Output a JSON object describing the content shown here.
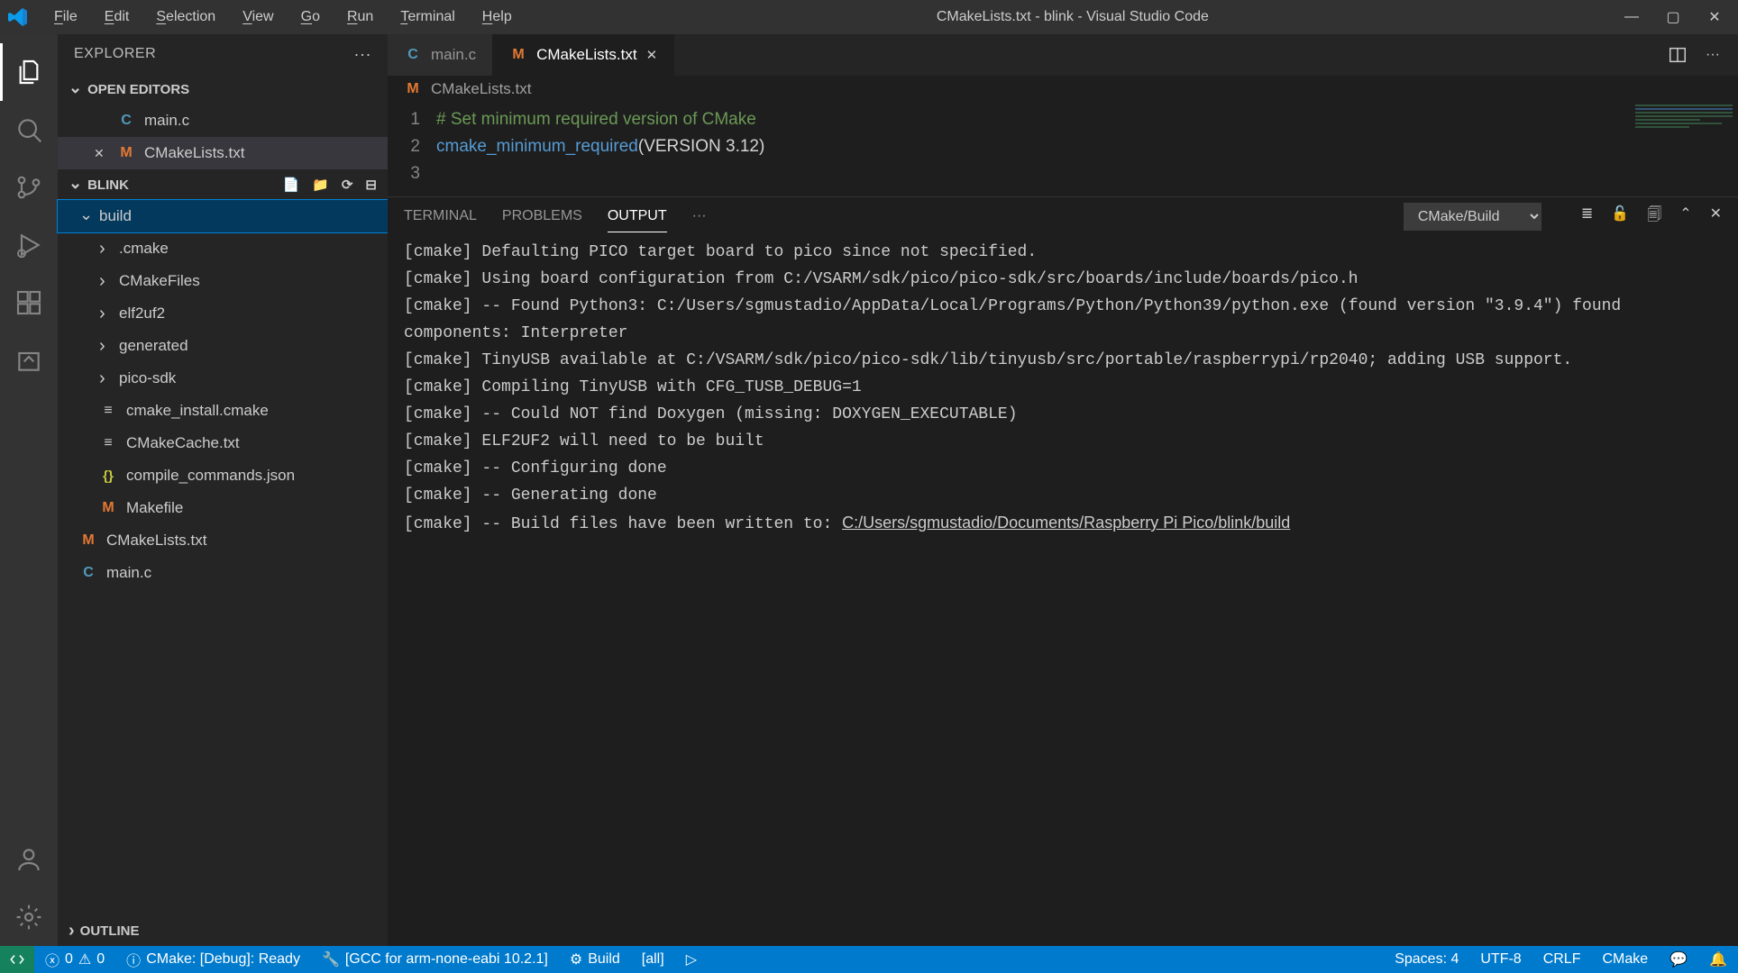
{
  "window": {
    "title": "CMakeLists.txt - blink - Visual Studio Code"
  },
  "menu": [
    "File",
    "Edit",
    "Selection",
    "View",
    "Go",
    "Run",
    "Terminal",
    "Help"
  ],
  "sidebar": {
    "title": "EXPLORER",
    "sections": {
      "open_editors": "OPEN EDITORS",
      "project": "BLINK",
      "outline": "OUTLINE"
    },
    "open_editors_items": [
      {
        "icon": "C",
        "name": "main.c",
        "active": false
      },
      {
        "icon": "M",
        "name": "CMakeLists.txt",
        "active": true
      }
    ],
    "tree": {
      "root": {
        "name": "build",
        "expanded": true
      },
      "children": [
        {
          "type": "folder",
          "name": ".cmake"
        },
        {
          "type": "folder",
          "name": "CMakeFiles"
        },
        {
          "type": "folder",
          "name": "elf2uf2"
        },
        {
          "type": "folder",
          "name": "generated"
        },
        {
          "type": "folder",
          "name": "pico-sdk"
        },
        {
          "type": "file",
          "icon": "≡",
          "cls": "fi-file",
          "name": "cmake_install.cmake"
        },
        {
          "type": "file",
          "icon": "≡",
          "cls": "fi-file",
          "name": "CMakeCache.txt"
        },
        {
          "type": "file",
          "icon": "{}",
          "cls": "fi-json",
          "name": "compile_commands.json"
        },
        {
          "type": "file",
          "icon": "M",
          "cls": "fi-make",
          "name": "Makefile"
        }
      ],
      "root_files": [
        {
          "icon": "M",
          "cls": "fi-m",
          "name": "CMakeLists.txt"
        },
        {
          "icon": "C",
          "cls": "fi-c",
          "name": "main.c"
        }
      ]
    }
  },
  "tabs": [
    {
      "icon": "C",
      "cls": "fi-c",
      "name": "main.c",
      "active": false
    },
    {
      "icon": "M",
      "cls": "fi-m",
      "name": "CMakeLists.txt",
      "active": true
    }
  ],
  "breadcrumb": {
    "icon": "M",
    "name": "CMakeLists.txt"
  },
  "code": {
    "lines": [
      {
        "n": "1",
        "comment": "# Set minimum required version of CMake"
      },
      {
        "n": "2",
        "func": "cmake_minimum_required",
        "args": "(VERSION 3.12)"
      },
      {
        "n": "3",
        "blank": true
      }
    ]
  },
  "panel": {
    "tabs": [
      "TERMINAL",
      "PROBLEMS",
      "OUTPUT"
    ],
    "active": "OUTPUT",
    "select": "CMake/Build",
    "output": [
      "[cmake] Defaulting PICO target board to pico since not specified.",
      "[cmake] Using board configuration from C:/VSARM/sdk/pico/pico-sdk/src/boards/include/boards/pico.h",
      "[cmake] -- Found Python3: C:/Users/sgmustadio/AppData/Local/Programs/Python/Python39/python.exe (found version \"3.9.4\") found components: Interpreter",
      "[cmake] TinyUSB available at C:/VSARM/sdk/pico/pico-sdk/lib/tinyusb/src/portable/raspberrypi/rp2040; adding USB support.",
      "[cmake] Compiling TinyUSB with CFG_TUSB_DEBUG=1",
      "[cmake] -- Could NOT find Doxygen (missing: DOXYGEN_EXECUTABLE)",
      "[cmake] ELF2UF2 will need to be built",
      "[cmake] -- Configuring done",
      "[cmake] -- Generating done"
    ],
    "output_last_prefix": "[cmake] -- Build files have been written to: ",
    "output_last_path": "C:/Users/sgmustadio/Documents/Raspberry Pi Pico/blink/build"
  },
  "status": {
    "errors": "0",
    "warnings": "0",
    "cmake": "CMake: [Debug]: Ready",
    "kit": "[GCC for arm-none-eabi 10.2.1]",
    "build": "Build",
    "target": "[all]",
    "spaces": "Spaces: 4",
    "encoding": "UTF-8",
    "eol": "CRLF",
    "lang": "CMake"
  }
}
